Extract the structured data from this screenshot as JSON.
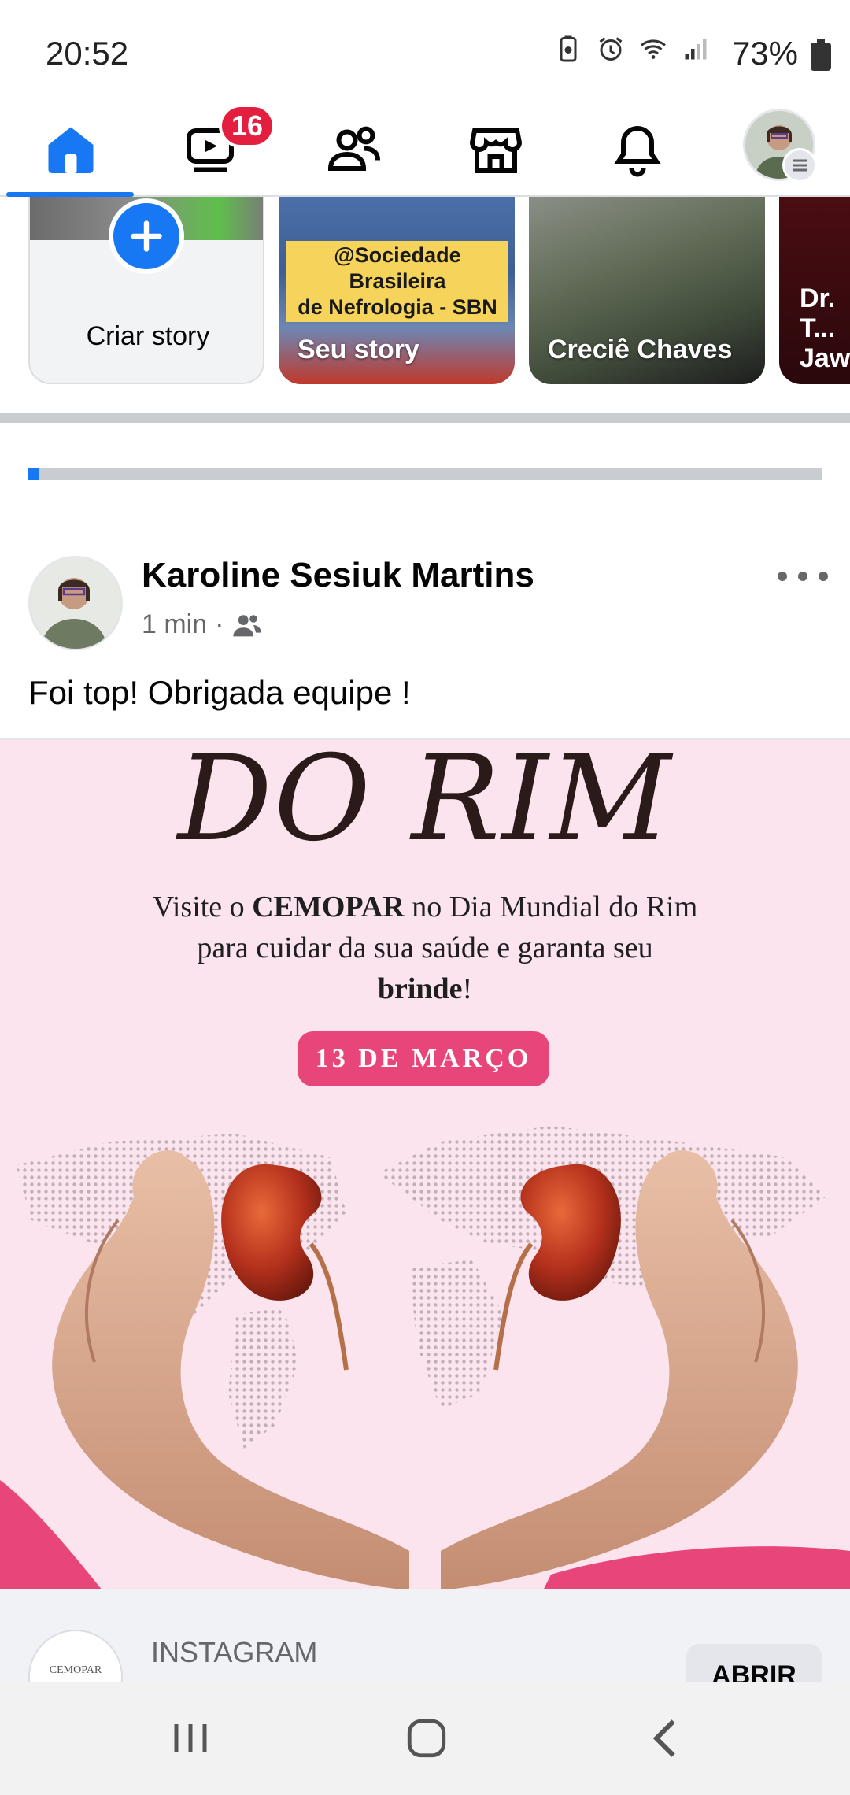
{
  "status_bar": {
    "time": "20:52",
    "battery": "73%"
  },
  "nav": {
    "badge_count": "16",
    "active_tab": "home",
    "accent": "#1877f2"
  },
  "stories": {
    "create_label": "Criar story",
    "items": [
      {
        "label": "Seu story",
        "tag_line1": "@Sociedade Brasileira",
        "tag_line2": "de Nefrologia - SBN"
      },
      {
        "label": "Creciê Chaves"
      },
      {
        "label": "Dr. T... Jaw..."
      }
    ]
  },
  "upload_progress": 0.014,
  "post": {
    "author": "Karoline Sesiuk Martins",
    "time": "1 min",
    "text": "Foi top! Obrigada equipe !",
    "image": {
      "title": "DO RIM",
      "line1_pre": "Visite o ",
      "line1_bold": "CEMOPAR",
      "line1_post": " no Dia Mundial do Rim",
      "line2": "para cuidar da sua saúde e garanta seu",
      "line3_bold": "brinde",
      "line3_post": "!",
      "date": "13 DE MARÇO",
      "date_color": "#e8457a"
    }
  },
  "link_preview": {
    "logo_text": "CEMOPAR",
    "source": "INSTAGRAM",
    "button": "ABRIR"
  },
  "icons": {
    "home": "home-icon",
    "video": "video-icon",
    "friends": "friends-icon",
    "marketplace": "marketplace-icon",
    "notifications": "bell-icon",
    "more": "more-icon"
  }
}
